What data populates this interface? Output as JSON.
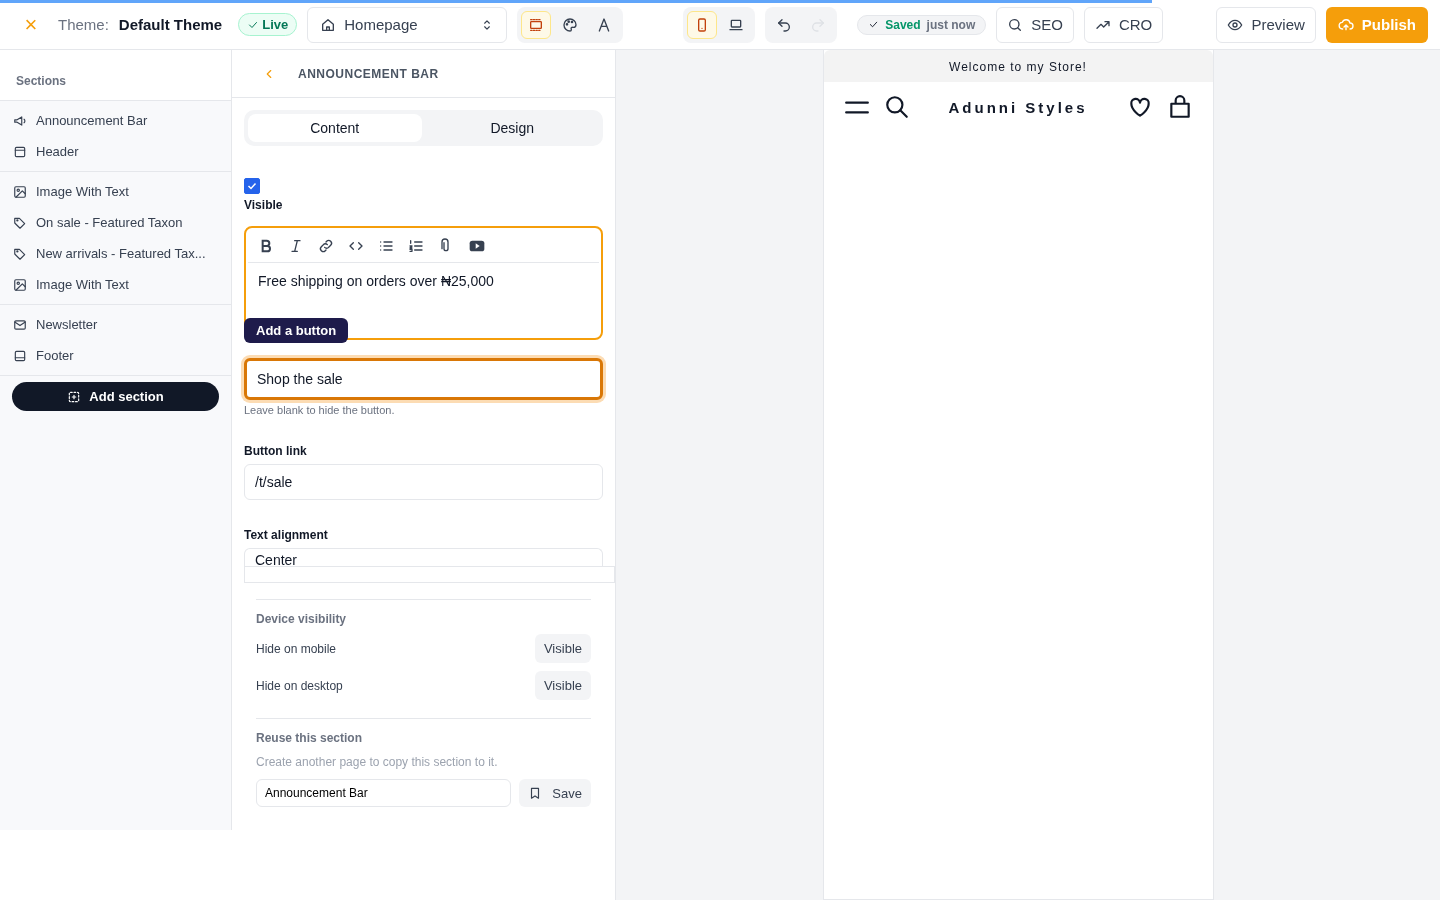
{
  "progress": {
    "level": 0.8
  },
  "topbar": {
    "close": "×",
    "theme_label": "Theme:",
    "theme_name": "Default Theme",
    "status": "Live",
    "page_select": "Homepage",
    "editor_modes": [
      {
        "kind": "sections",
        "selected": true
      },
      {
        "kind": "palette",
        "selected": false
      },
      {
        "kind": "typography",
        "selected": false
      }
    ],
    "devices": [
      {
        "kind": "mobile",
        "selected": true
      },
      {
        "kind": "desktop",
        "selected": false
      }
    ],
    "history": [
      {
        "kind": "undo",
        "disabled": false
      },
      {
        "kind": "redo",
        "disabled": true
      }
    ],
    "save_state": {
      "label": "Saved",
      "time": "just now"
    },
    "tools": [
      {
        "kind": "search",
        "label": "SEO"
      },
      {
        "kind": "trend",
        "label": "CRO"
      }
    ],
    "preview": "Preview",
    "publish": "Publish"
  },
  "sidebar": {
    "title": "Sections",
    "groups": [
      [
        {
          "kind": "announcement",
          "label": "Announcement Bar"
        },
        {
          "kind": "header",
          "label": "Header"
        }
      ],
      [
        {
          "kind": "image",
          "label": "Image With Text"
        },
        {
          "kind": "tag",
          "label": "On sale - Featured Taxon"
        },
        {
          "kind": "tag",
          "label": "New arrivals - Featured Tax..."
        },
        {
          "kind": "image",
          "label": "Image With Text"
        }
      ],
      [
        {
          "kind": "mail",
          "label": "Newsletter"
        },
        {
          "kind": "footer",
          "label": "Footer"
        }
      ]
    ],
    "add_button": "Add section"
  },
  "panel": {
    "title": "ANNOUNCEMENT BAR",
    "tabs": [
      {
        "label": "Content",
        "selected": true
      },
      {
        "label": "Design",
        "selected": false
      }
    ],
    "visible": {
      "label": "Visible",
      "checked": true
    },
    "editor": {
      "tools": [
        {
          "kind": "bold"
        },
        {
          "kind": "italic"
        },
        {
          "kind": "link"
        },
        {
          "kind": "code"
        },
        {
          "kind": "bullets"
        },
        {
          "kind": "numbers"
        },
        {
          "kind": "attach"
        },
        {
          "kind": "video"
        }
      ],
      "text": "Free shipping on orders over ₦25,000"
    },
    "tooltip": "Add a button",
    "button_text": {
      "value": "Shop the sale",
      "hint": "Leave blank to hide the button."
    },
    "button_link": {
      "label": "Button link",
      "value": "/t/sale"
    },
    "text_alignment": {
      "label": "Text alignment",
      "value": "Center"
    },
    "device_visibility": {
      "title": "Device visibility",
      "rows": [
        {
          "label": "Hide on mobile",
          "value": "Visible"
        },
        {
          "label": "Hide on desktop",
          "value": "Visible"
        }
      ]
    },
    "reuse": {
      "title": "Reuse this section",
      "hint": "Create another page to copy this section to it.",
      "value": "Announcement Bar",
      "save": "Save"
    }
  },
  "store": {
    "announcement": "Welcome to my Store!",
    "brand": "Adunni Styles"
  }
}
